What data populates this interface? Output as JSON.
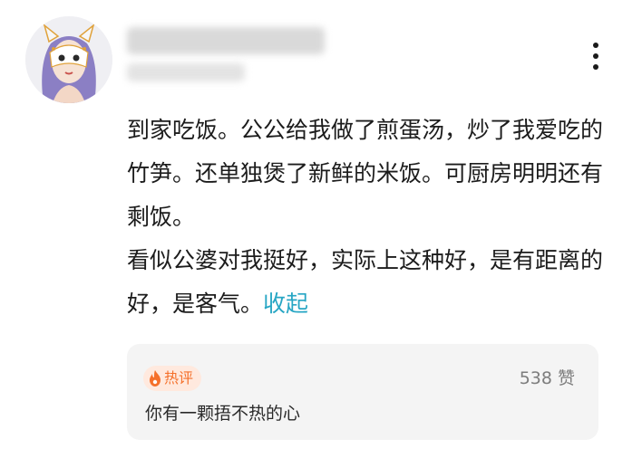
{
  "post": {
    "paragraphs": [
      "到家吃饭。公公给我做了煎蛋汤，炒了我爱吃的竹笋。还单独煲了新鲜的米饭。可厨房明明还有剩饭。",
      "看似公婆对我挺好，实际上这种好，是有距离的好，是客气。"
    ],
    "collapse_label": "收起"
  },
  "hot_comment": {
    "badge_label": "热评",
    "badge_icon": "flame-icon",
    "likes": "538 赞",
    "text": "你有一颗捂不热的心"
  },
  "icons": {
    "more": "more-vertical-icon",
    "avatar": "avatar-image"
  },
  "colors": {
    "link": "#27a6c4",
    "badge": "#f5702a",
    "card_bg": "#f4f4f4"
  }
}
